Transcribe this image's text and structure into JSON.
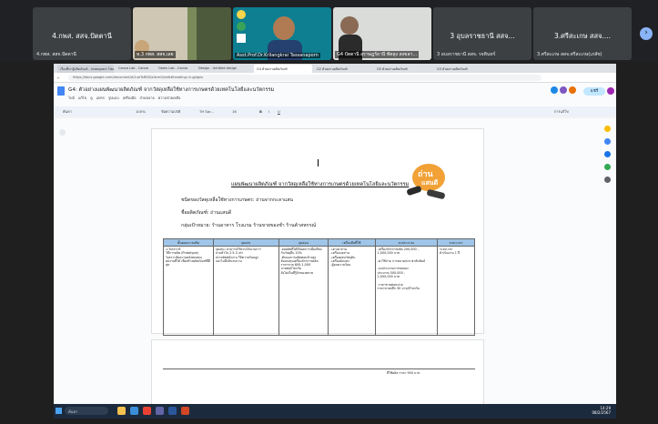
{
  "meeting": {
    "tiles": [
      {
        "name": "4.กพส. สสจ.ปัตตานี",
        "sub": "4.กพส. สสจ.ปัตตานี"
      },
      {
        "name": "3 อุบลราชธานี สสจ...",
        "sub": "3 อบลราชธานี สสจ. รจทินทร์"
      },
      {
        "name": "3.ศรีสะเกษ สสจ....",
        "sub": "3.ศรีสะเกษ สสจ.ศรีสะเกษ(เภสัช)"
      }
    ],
    "videos": [
      {
        "caption": "ห.3 กพส. สสจ.เลย"
      },
      {
        "caption": "Asst.Prof.Dr.Krilangkrai Tassanaporn"
      },
      {
        "caption": "G4 ปัตตานี สุราษฎร์ธานี พัทลุง สงขลา..."
      }
    ],
    "next_icon": "chevron-right-icon"
  },
  "browser": {
    "tabs": [
      "เรื่องที่น่ารู้ผลิตภัณฑ์ - Instagram โฟลเดอร์",
      "Canva Lab - Canva",
      "Ooms Lab - Canva",
      "Design - Untitled design",
      "G4 ด้วยผ่านผลิตภัณฑ์",
      "G2 ด้วยผ่านผลิตภัณฑ์",
      "G5 ด้วยผ่านผลิตภัณฑ์",
      "G3 ด้วยผ่านผลิตภัณฑ์"
    ],
    "url": "https://docs.google.com/document/d/1ueTsfN3Qz4cmG/edit#heading=h.gjdgxs"
  },
  "doc": {
    "title": "G4: ตัวอย่างแผนพัฒนาผลิตภัณฑ์ จากวัสดุเหลือใช้ทางการเกษตรด้วยเทคโนโลยีและนวัตกรรม",
    "menus": [
      "ไฟล์",
      "แก้ไข",
      "ดู",
      "แทรก",
      "รูปแบบ",
      "เครื่องมือ",
      "ส่วนขยาย",
      "ความช่วยเหลือ"
    ],
    "share_label": "แชร์",
    "toolbar": {
      "search": "ค้นหา",
      "zoom": "100%",
      "style": "ข้อความปกติ",
      "font": "TH Sar...",
      "size": "16",
      "mode": "การแก้ไข"
    },
    "heading": "แผนพัฒนาผลิตภัณฑ์ จากวัสดุเหลือใช้ทางการเกษตรด้วยเทคโนโลยีและนวัตกรรม",
    "info": [
      "ชนิดของวัสดุเหลือใช้ทางการเกษตร: ถ่านจากกะลาแสน",
      "ชื่อผลิตภัณฑ์: ถ่านแสนดี",
      "กลุ่มเป้าหมาย: ร้านอาหาร โรงแรม ร้านขายของชำ ร้านค้าสหกรณ์"
    ],
    "logo_text": [
      "ถ่าน",
      "แสนดี"
    ],
    "table": {
      "headers": [
        "ขั้นตอนการผลิต",
        "จุดเด่น",
        "จุดอ่อน",
        "เครื่องมือที่ใช้",
        "งบประมาณ",
        "ระยะเวลา"
      ],
      "cells": [
        "1.วิเคราะห์\nวิธีการผลิต (Prototype) วิเคราะห์ผลงานหลังทดสอบ\nผลงานที่ได้ เพื่อสร้างผลิตภัณฑ์ที่ดีสุด",
        "จุดเด่น: สามารถใช้งานได้นานกว่า\nถ่านทั่วไป 2.5-3 เท่า\nประหยัดพลังงาน ให้ความร้อนสูง\nและไม่มีกลิ่นรบกวน",
        "-ผลผลิตที่ได้มีน้อยกว่าเมื่อเทียบ\nกับวัสดุอื่น 10%\n-ต้นทุนการผลิตค่อนข้างสูง\nต้องลงทุนเครื่องจักรการผลิต\nราคาขาย 600-1,000\nบาทต่อกิโลกรัม\nยังไม่เป็นที่รู้จักของตลาด",
        "-เตาเผาถ่าน\n-เครื่องบดถ่าน\n-เครื่องผสมวัตถุดิบ\n-เครื่องอัดแท่ง\n-ตู้อบความร้อน",
        "-เครื่องจักรการผลิต 200,000 -\n1,000,000 บาท\n\n-ค่าใช้จ่าย การตลาด/ประชาสัมพันธ์\n\n-งบประมาณการทดลอง\nประมาณ 500,000 -\n2,000,000 บาท\n\n-ราคาขายต่อหน่วย\nราคาขายปลีก 30 บาท/กิโลกรัม",
        "ระยะเวลา\nดำเนินงาน 1 ปี"
      ]
    },
    "page2_text": "ที่ใช้ผลิต ราคา 900 บาท"
  },
  "taskbar": {
    "search": "ค้นหา",
    "time": "14:29",
    "date": "08/2/2567"
  },
  "colors": {
    "table_header": "#9fc5e8",
    "share": "#c2e7ff",
    "logo": "#f1a135"
  }
}
